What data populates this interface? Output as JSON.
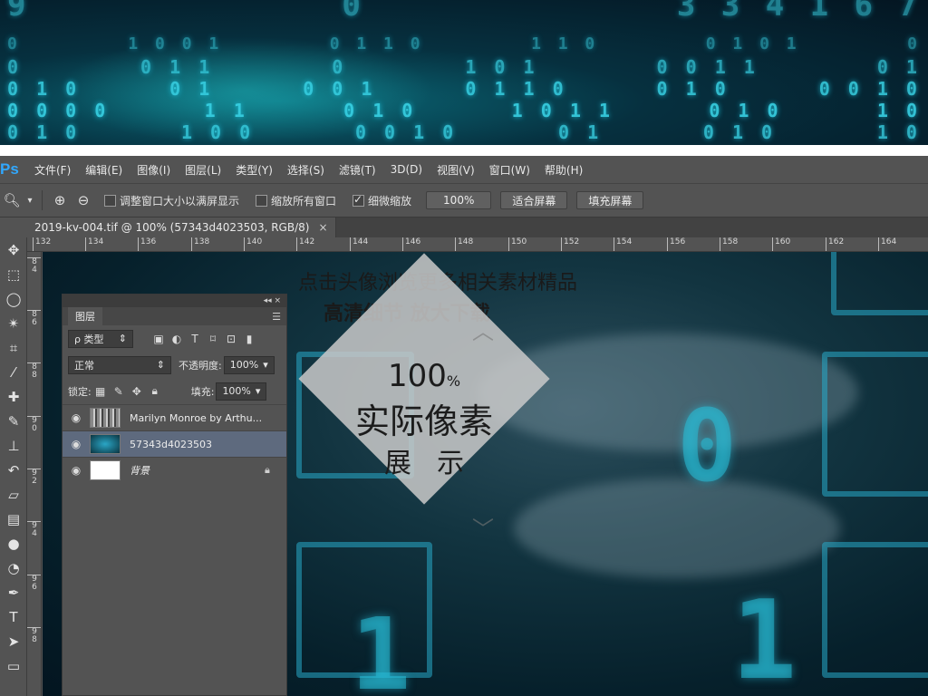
{
  "banner": {
    "row1": [
      "9",
      "0",
      "3 3 4 1 6 7"
    ],
    "row2": [
      "0",
      "1 0 0 1",
      "0 1 1 0",
      "1 1 0",
      "0 1 0 1",
      "0"
    ],
    "row3": [
      "0",
      "0 1 1",
      "0",
      "1 0 1",
      "0 0 1 1",
      "0 1"
    ],
    "row4": [
      "0 1 0",
      "0 1",
      "0 0 1",
      "0 1 1 0",
      "0 1 0",
      "0 0 1 0"
    ],
    "row5": [
      "0 0 0 0",
      "1 1",
      "0 1 0",
      "1 0 1 1",
      "0 1 0",
      "1 0"
    ],
    "row6": [
      "0 1 0",
      "1 0 0",
      "0 0 1 0",
      "0 1",
      "0 1 0",
      "1 0"
    ]
  },
  "app": {
    "logo": "Ps"
  },
  "menu": [
    "文件(F)",
    "编辑(E)",
    "图像(I)",
    "图层(L)",
    "类型(Y)",
    "选择(S)",
    "滤镜(T)",
    "3D(D)",
    "视图(V)",
    "窗口(W)",
    "帮助(H)"
  ],
  "options": {
    "zoom_icon": "zoom-icon",
    "chk1_label": "调整窗口大小以满屏显示",
    "chk2_label": "缩放所有窗口",
    "chk3_label": "细微缩放",
    "chk3_checked": true,
    "btn_100": "100%",
    "btn_fit": "适合屏幕",
    "btn_fill": "填充屏幕"
  },
  "document": {
    "tab_title": "2019-kv-004.tif @ 100% (57343d4023503, RGB/8)",
    "close": "×"
  },
  "ruler": {
    "h_ticks": [
      "132",
      "134",
      "136",
      "138",
      "140",
      "142",
      "144",
      "146",
      "148",
      "150",
      "152",
      "154",
      "156",
      "158",
      "160",
      "162",
      "164"
    ],
    "v_ticks": [
      "8\n4",
      "8\n6",
      "8\n8",
      "9\n0",
      "9\n2",
      "9\n4",
      "9\n6",
      "9\n8"
    ]
  },
  "tools": [
    "move-icon",
    "marquee-icon",
    "lasso-icon",
    "magic-wand-icon",
    "crop-icon",
    "eyedropper-icon",
    "healing-icon",
    "brush-icon",
    "stamp-icon",
    "history-brush-icon",
    "eraser-icon",
    "gradient-icon",
    "blur-icon",
    "dodge-icon",
    "pen-icon",
    "type-icon",
    "path-select-icon",
    "rectangle-icon"
  ],
  "overlay": {
    "line1": "点击头像浏览更多相关素材精品",
    "line2": "高清细节    放大下载"
  },
  "badge": {
    "percent": "100",
    "percent_sign": "%",
    "main": "实际像素",
    "sub": "展示"
  },
  "layers_panel": {
    "top_controls": "◂◂  ×",
    "tab": "图层",
    "menu_icon": "panel-menu-icon",
    "filter_label": "ρ 类型",
    "blend_mode": "正常",
    "opacity_label": "不透明度:",
    "opacity_value": "100%",
    "lock_label": "锁定:",
    "fill_label": "填充:",
    "fill_value": "100%",
    "layers": [
      {
        "name": "Marilyn Monroe by Arthu...",
        "thumb": "photo",
        "selected": false,
        "italic": false,
        "locked": false
      },
      {
        "name": "57343d4023503",
        "thumb": "digi",
        "selected": true,
        "italic": false,
        "locked": false
      },
      {
        "name": "背景",
        "thumb": "white",
        "selected": false,
        "italic": true,
        "locked": true
      }
    ]
  }
}
